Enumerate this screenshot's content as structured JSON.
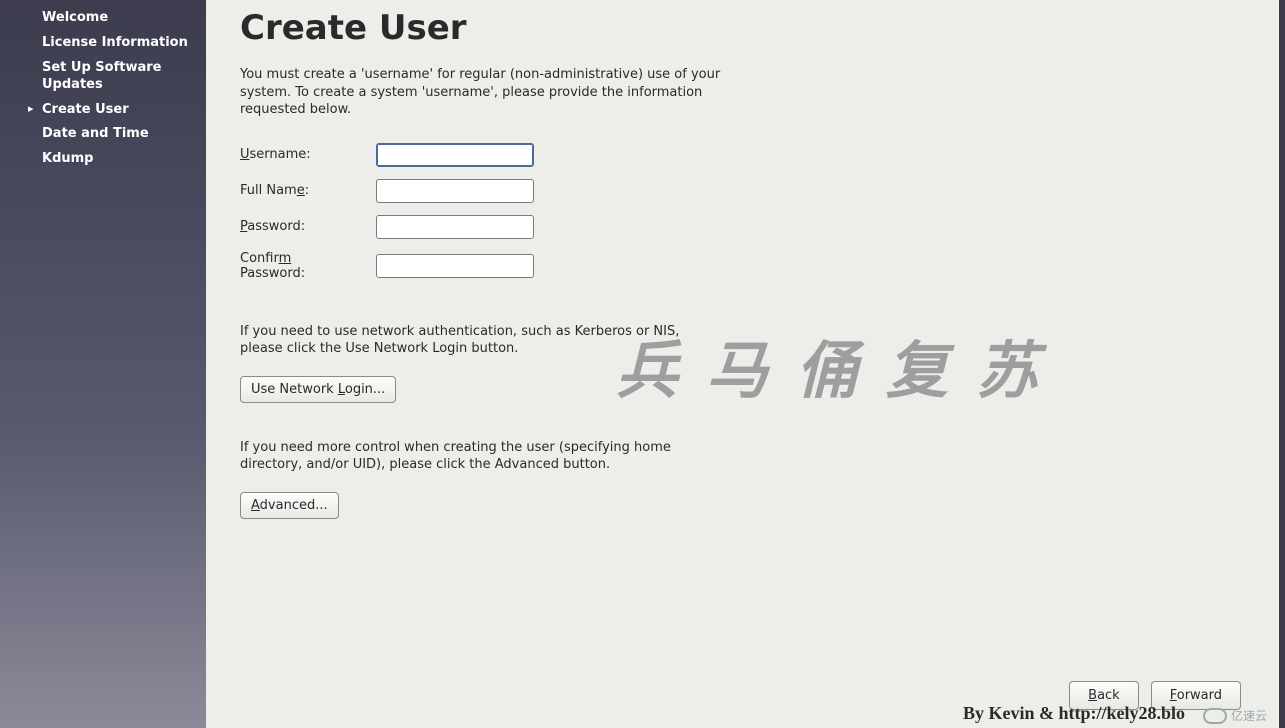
{
  "sidebar": {
    "items": [
      {
        "label": "Welcome"
      },
      {
        "label": "License Information"
      },
      {
        "label": "Set Up Software Updates"
      },
      {
        "label": "Create User"
      },
      {
        "label": "Date and Time"
      },
      {
        "label": "Kdump"
      }
    ],
    "active_index": 3
  },
  "page": {
    "title": "Create User",
    "intro": "You must create a 'username' for regular (non-administrative) use of your system.  To create a system 'username', please provide the information requested below."
  },
  "form": {
    "username": {
      "label_pre": "U",
      "label_post": "sername:",
      "value": ""
    },
    "fullname": {
      "label_pre": "Full Nam",
      "label_mnem": "e",
      "label_post": ":",
      "value": ""
    },
    "password": {
      "label_pre": "P",
      "label_post": "assword:",
      "value": ""
    },
    "confirm": {
      "label_pre": "Confir",
      "label_mnem": "m",
      "label_post": " Password:",
      "value": ""
    }
  },
  "network_text": "If you need to use network authentication, such as Kerberos or NIS, please click the Use Network Login button.",
  "network_button": {
    "pre": "Use Network ",
    "mnem": "L",
    "post": "ogin..."
  },
  "advanced_text": "If you need more control when creating the user (specifying home directory, and/or UID), please click the Advanced button.",
  "advanced_button": {
    "mnem": "A",
    "post": "dvanced..."
  },
  "nav": {
    "back": {
      "mnem": "B",
      "post": "ack"
    },
    "forward": {
      "mnem": "F",
      "post": "orward"
    }
  },
  "watermark": {
    "cn": "兵马俑复苏",
    "en": "By Kevin & http://kely28.blo",
    "logo_text": "亿速云"
  }
}
